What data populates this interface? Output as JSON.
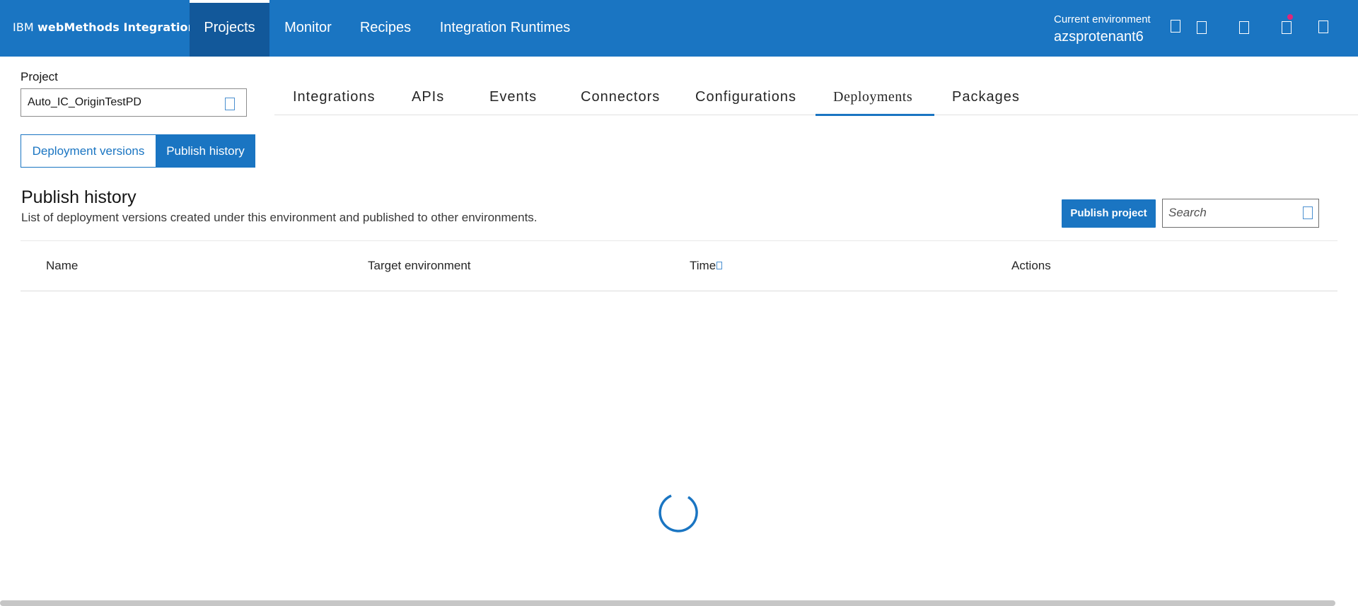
{
  "header": {
    "brand_ibm": "IBM",
    "brand_product": "webMethods Integration",
    "nav": [
      {
        "label": "Projects",
        "active": true
      },
      {
        "label": "Monitor",
        "active": false
      },
      {
        "label": "Recipes",
        "active": false
      },
      {
        "label": "Integration Runtimes",
        "active": false
      }
    ],
    "environment_label": "Current environment",
    "environment_name": "azsprotenant6",
    "icons": [
      "help-icon",
      "notifications-icon",
      "apps-icon",
      "alerts-icon",
      "user-icon"
    ],
    "notification_dot_color": "#e0267a"
  },
  "project": {
    "label": "Project",
    "value": "Auto_IC_OriginTestPD"
  },
  "tabs": [
    {
      "label": "Integrations",
      "active": false
    },
    {
      "label": "APIs",
      "active": false
    },
    {
      "label": "Events",
      "active": false
    },
    {
      "label": "Connectors",
      "active": false
    },
    {
      "label": "Configurations",
      "active": false
    },
    {
      "label": "Deployments",
      "active": true
    },
    {
      "label": "Packages",
      "active": false
    }
  ],
  "subview": {
    "deployment_versions": "Deployment versions",
    "publish_history": "Publish history",
    "selected": "Publish history"
  },
  "section": {
    "title": "Publish history",
    "description": "List of deployment versions created under this environment and published to other environments.",
    "publish_button": "Publish project",
    "search_placeholder": "Search",
    "search_value": ""
  },
  "table": {
    "columns": [
      "Name",
      "Target environment",
      "Time",
      "Actions"
    ],
    "rows": [],
    "loading": true
  },
  "colors": {
    "brand_blue": "#1a75c2",
    "nav_active": "#12589a"
  }
}
